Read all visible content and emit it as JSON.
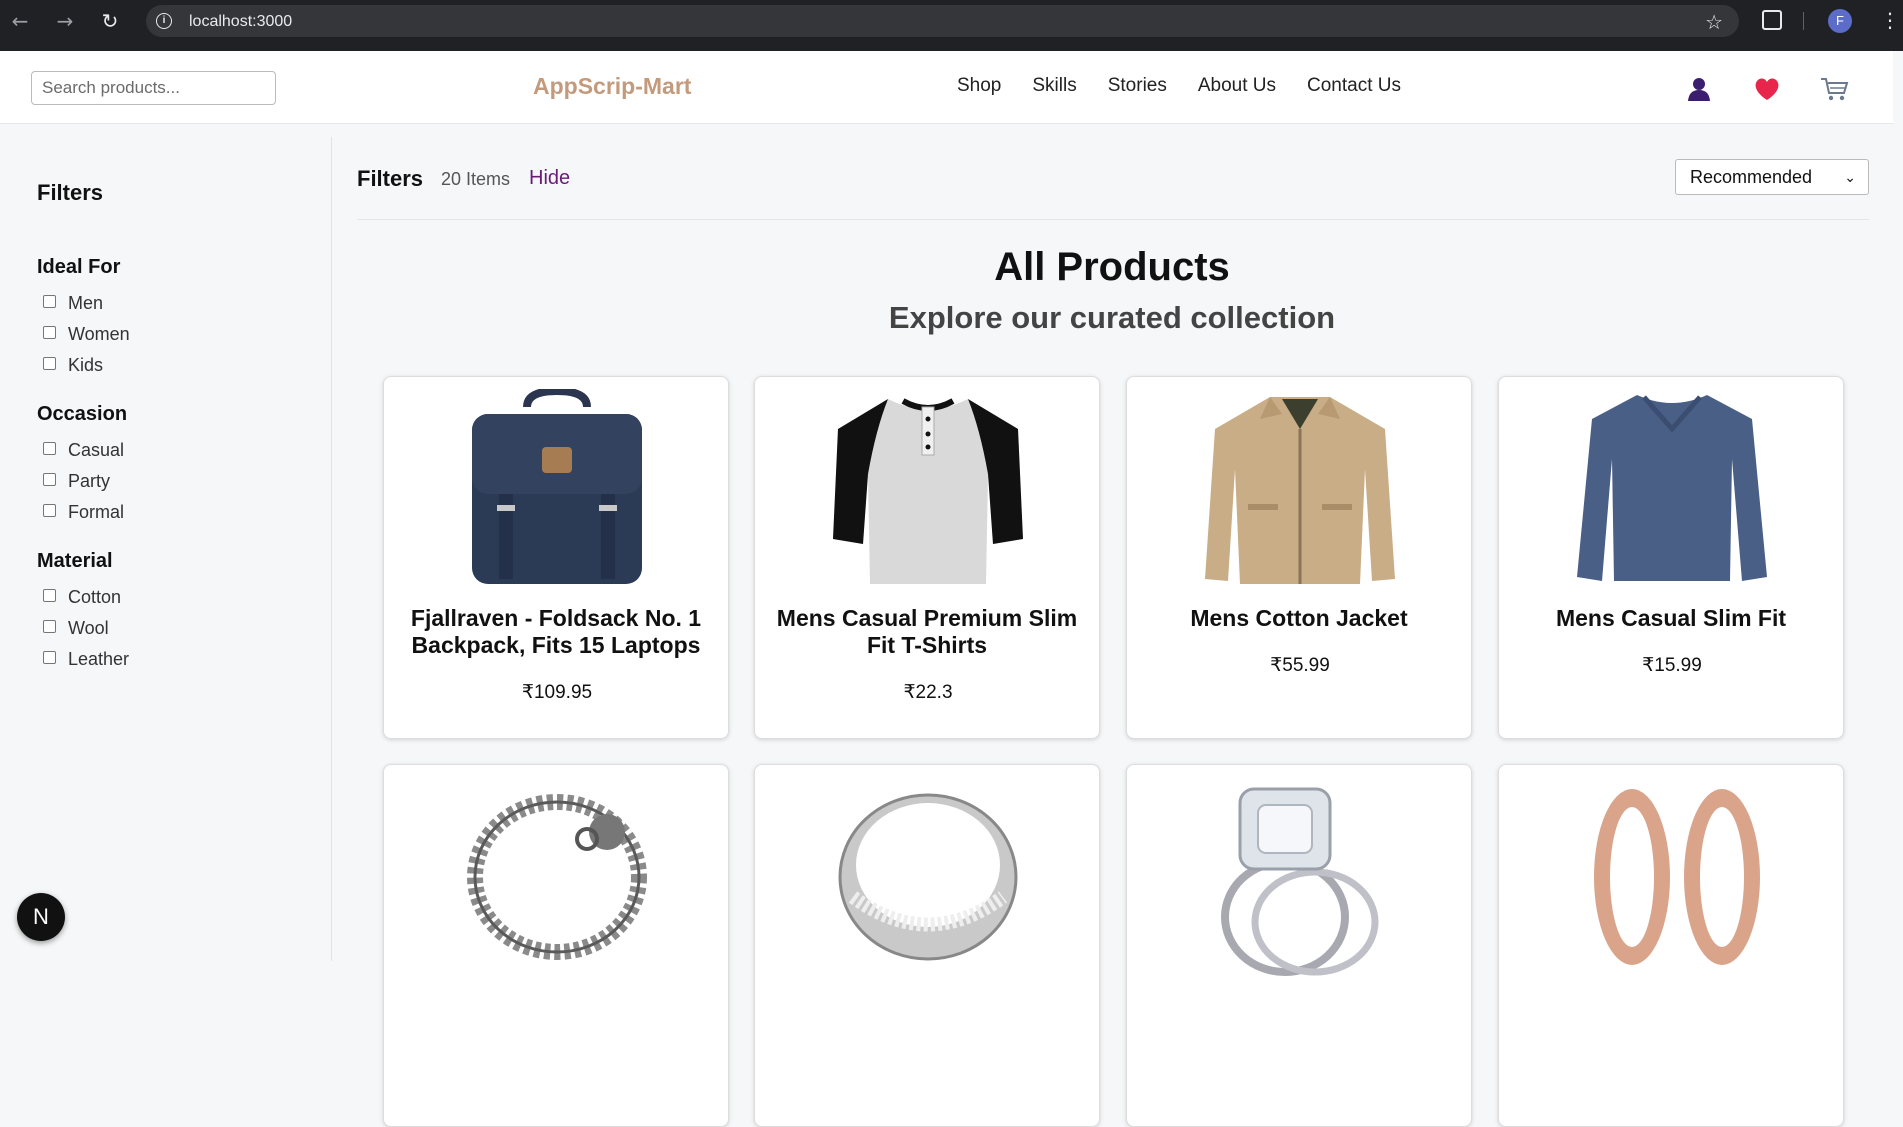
{
  "browser": {
    "url": "localhost:3000",
    "profile_initial": "F"
  },
  "header": {
    "search_placeholder": "Search products...",
    "brand": "AppScrip-Mart",
    "nav": [
      "Shop",
      "Skills",
      "Stories",
      "About Us",
      "Contact Us"
    ],
    "icons": [
      "user-icon",
      "heart-icon",
      "cart-icon"
    ],
    "brand_color": "#c49a7d"
  },
  "sidebar": {
    "title": "Filters",
    "groups": [
      {
        "title": "Ideal For",
        "options": [
          "Men",
          "Women",
          "Kids"
        ]
      },
      {
        "title": "Occasion",
        "options": [
          "Casual",
          "Party",
          "Formal"
        ]
      },
      {
        "title": "Material",
        "options": [
          "Cotton",
          "Wool",
          "Leather"
        ]
      }
    ]
  },
  "toolbar": {
    "title": "Filters",
    "count": "20 Items",
    "hide": "Hide",
    "sort_selected": "Recommended"
  },
  "main": {
    "title": "All Products",
    "subtitle": "Explore our curated collection"
  },
  "products": [
    {
      "title": "Fjallraven - Foldsack No. 1 Backpack, Fits 15 Laptops",
      "price": "₹109.95",
      "image": "backpack"
    },
    {
      "title": "Mens Casual Premium Slim Fit T-Shirts",
      "price": "₹22.3",
      "image": "raglan-tshirt"
    },
    {
      "title": "Mens Cotton Jacket",
      "price": "₹55.99",
      "image": "jacket"
    },
    {
      "title": "Mens Casual Slim Fit",
      "price": "₹15.99",
      "image": "long-sleeve-tee"
    },
    {
      "title": "",
      "price": "",
      "image": "dragon-bracelet"
    },
    {
      "title": "",
      "price": "",
      "image": "silver-ring"
    },
    {
      "title": "",
      "price": "",
      "image": "diamond-ring-set"
    },
    {
      "title": "",
      "price": "",
      "image": "rose-gold-tunnels"
    }
  ],
  "badge": "N"
}
